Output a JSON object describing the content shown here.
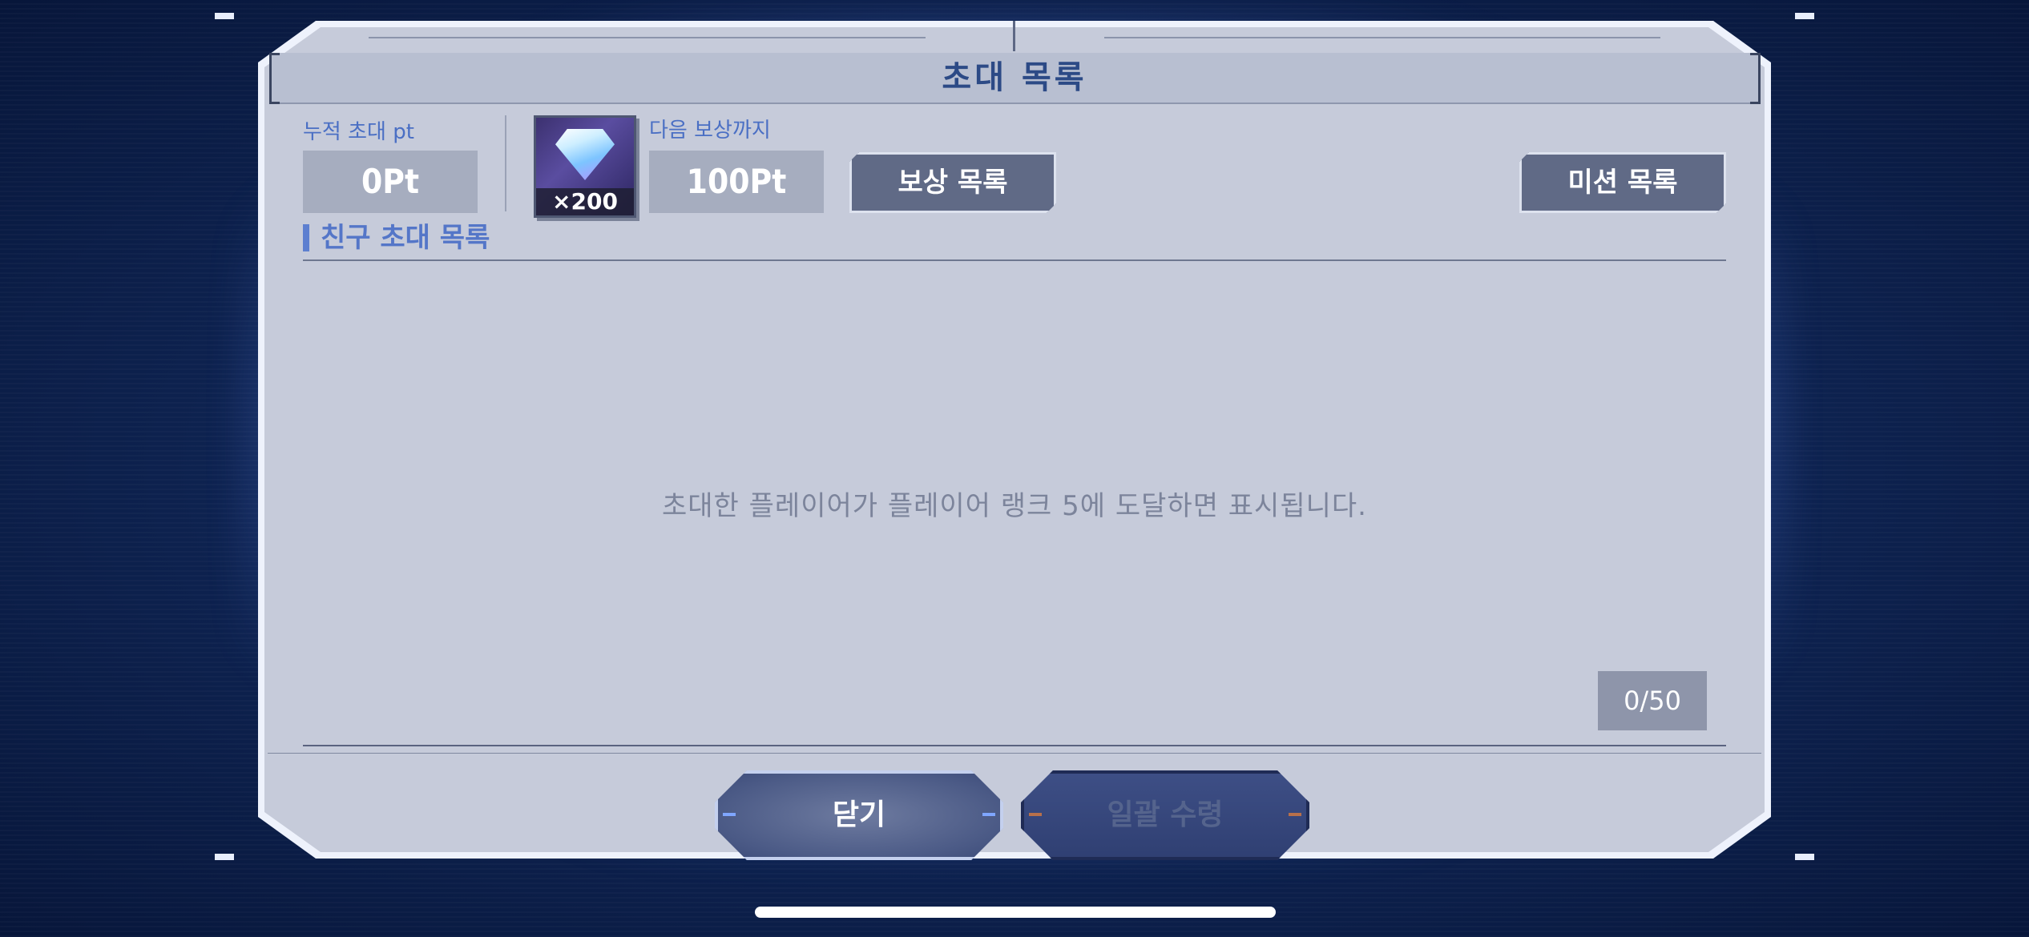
{
  "dialog": {
    "title": "초대 목록",
    "accumulated": {
      "label": "누적 초대 pt",
      "value": "0Pt"
    },
    "next_reward": {
      "label": "다음 보상까지",
      "value": "100Pt",
      "reward_icon": "diamond-icon",
      "reward_count": "×200"
    },
    "buttons": {
      "reward_list": "보상 목록",
      "mission_list": "미션 목록"
    },
    "friends_section": {
      "title": "친구 초대 목록",
      "empty_message": "초대한 플레이어가 플레이어 랭크 5에 도달하면 표시됩니다.",
      "counter": "0/50"
    },
    "footer": {
      "close": "닫기",
      "claim_all": "일괄 수령"
    }
  },
  "colors": {
    "background": "#0f2555",
    "panel": "#c6cbda",
    "accent_blue": "#4a6fc4",
    "title": "#2c4a86",
    "button_slate": "#606a86"
  }
}
